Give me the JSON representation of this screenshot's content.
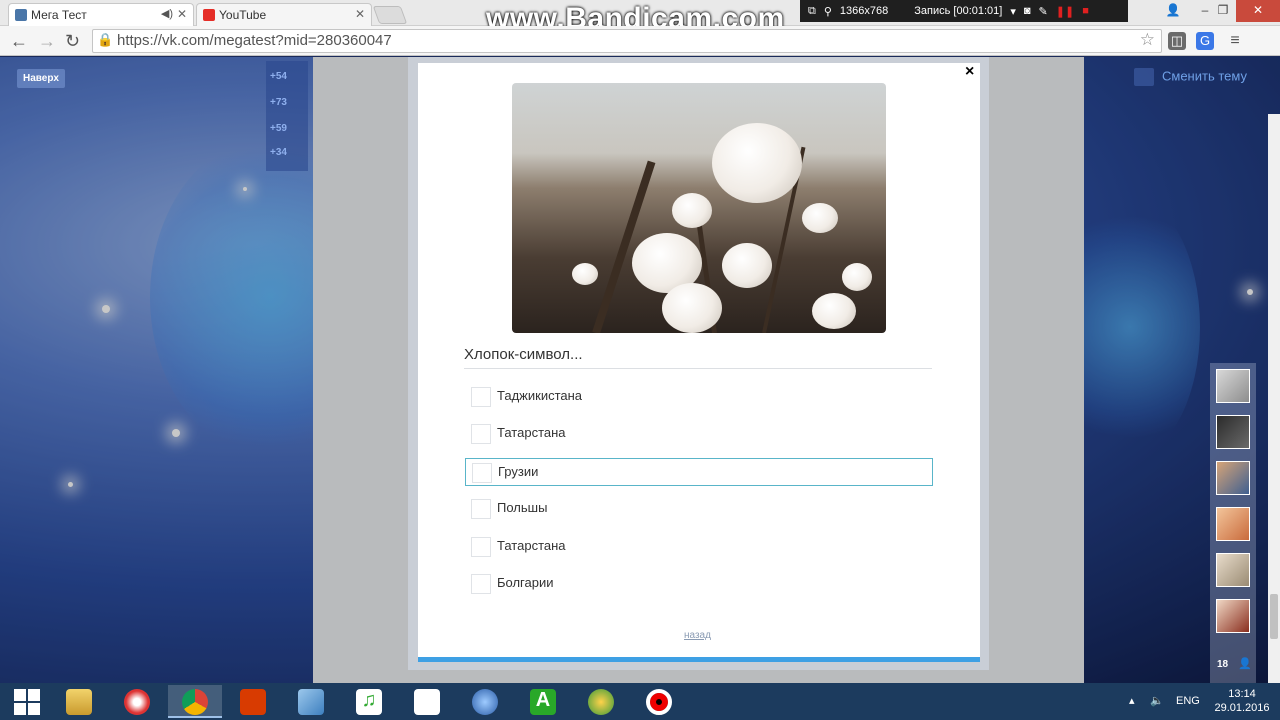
{
  "browser": {
    "tabs": [
      {
        "title": "Мега Тест",
        "active": true
      },
      {
        "title": "YouTube",
        "active": false
      }
    ],
    "url": "https://vk.com/megatest?mid=280360047"
  },
  "recorder": {
    "watermark": "www.Bandicam.com",
    "resolution": "1366x768",
    "status": "Запись [00:01:01]"
  },
  "page": {
    "naverh_label": "Наверх",
    "counters": [
      "+54",
      "+73",
      "+59",
      "+34"
    ],
    "theme_button": "Сменить тему",
    "friends_count": "18"
  },
  "quiz": {
    "close_glyph": "×",
    "question": "Хлопок-символ...",
    "options": [
      {
        "label": "Таджикистана",
        "selected": false
      },
      {
        "label": "Татарстана",
        "selected": false
      },
      {
        "label": "Грузии",
        "selected": true
      },
      {
        "label": "Польшы",
        "selected": false
      },
      {
        "label": "Татарстана",
        "selected": false
      },
      {
        "label": "Болгарии",
        "selected": false
      }
    ],
    "back_link": "назад",
    "progress": 1.0
  },
  "taskbar": {
    "language": "ENG",
    "time": "13:14",
    "date": "29.01.2016"
  },
  "colors": {
    "accent": "#3ea0e4",
    "selected_border": "#59b5c9",
    "taskbar": "#1c3b5e",
    "link": "#8a9bb3"
  }
}
